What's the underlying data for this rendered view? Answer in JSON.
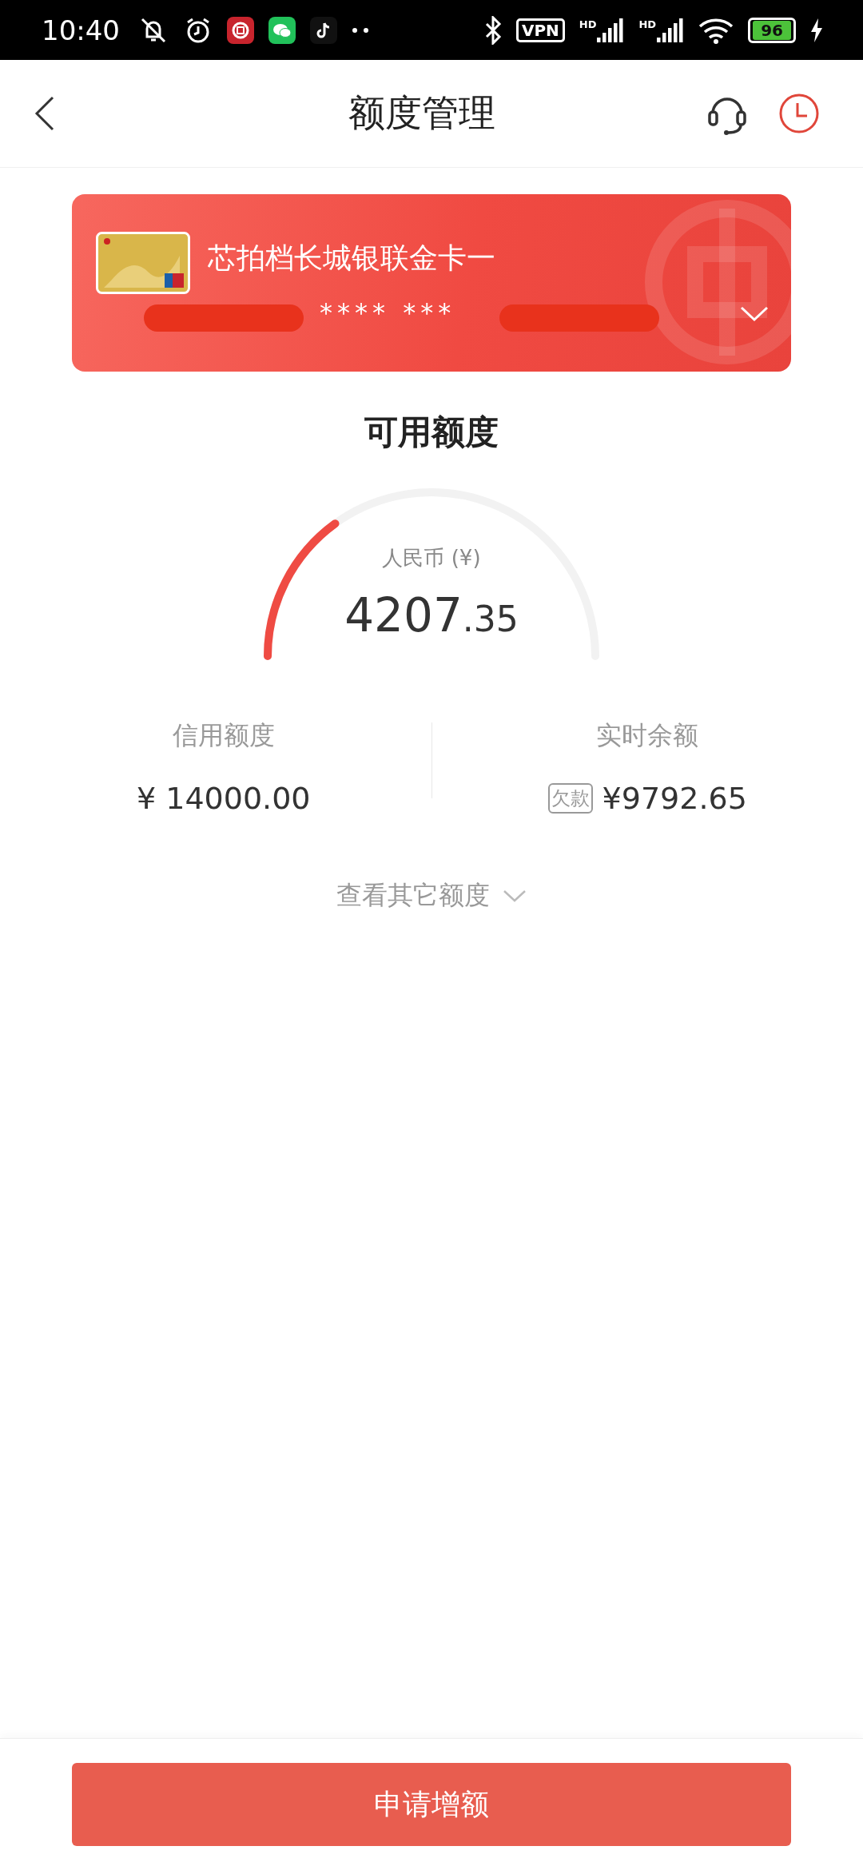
{
  "status_bar": {
    "time": "10:40",
    "vpn": "VPN",
    "network_labels": [
      "HD",
      "HD"
    ],
    "battery": "96"
  },
  "header": {
    "title": "额度管理"
  },
  "card": {
    "name": "芯拍档长城银联金卡一",
    "number": "**** ***"
  },
  "available": {
    "title": "可用额度",
    "currency": "人民币 (¥)",
    "amount_int": "4207",
    "amount_dec": ".35"
  },
  "stats": [
    {
      "label": "信用额度",
      "value": "¥ 14000.00"
    },
    {
      "label": "实时余额",
      "tag": "欠款",
      "value": "¥9792.65"
    }
  ],
  "more_link": "查看其它额度",
  "apply_button": "申请增额"
}
